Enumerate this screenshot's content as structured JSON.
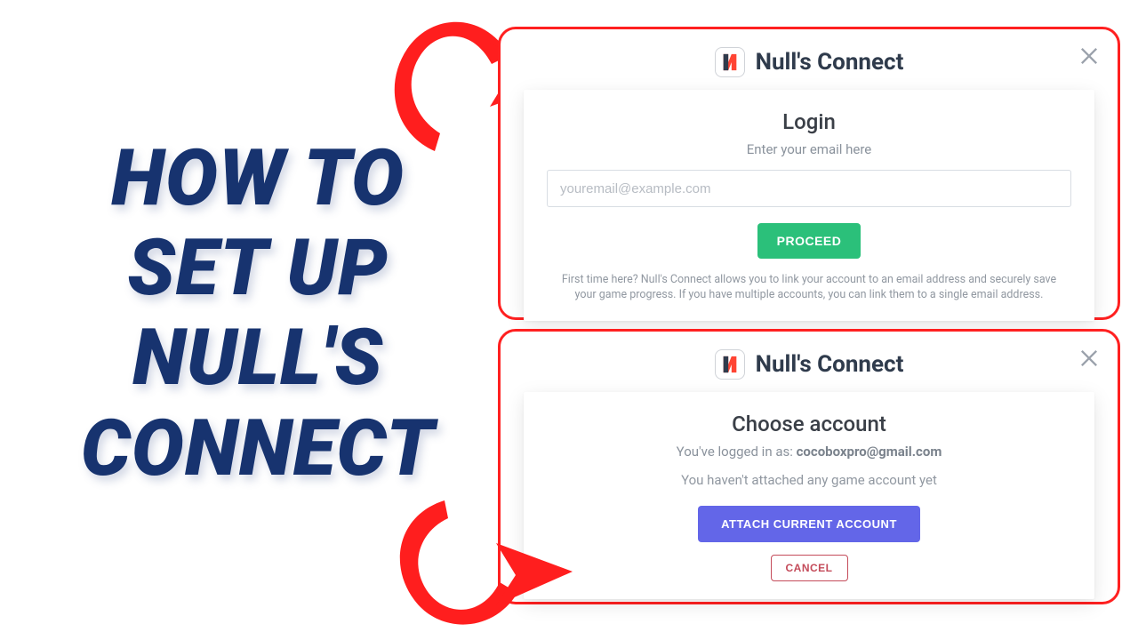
{
  "headline": "HOW TO SET UP NULL'S CONNECT",
  "brand_title": "Null's Connect",
  "login": {
    "title": "Login",
    "subtitle": "Enter your email here",
    "email_placeholder": "youremail@example.com",
    "proceed_label": "PROCEED",
    "fine_print": "First time here? Null's Connect allows you to link your account to an email address and securely save your game progress. If you have multiple accounts, you can link them to a single email address."
  },
  "choose": {
    "title": "Choose account",
    "logged_in_prefix": "You've logged in as: ",
    "logged_in_email": "cocoboxpro@gmail.com",
    "no_account_msg": "You haven't attached any game account yet",
    "attach_label": "ATTACH CURRENT ACCOUNT",
    "cancel_label": "CANCEL"
  }
}
